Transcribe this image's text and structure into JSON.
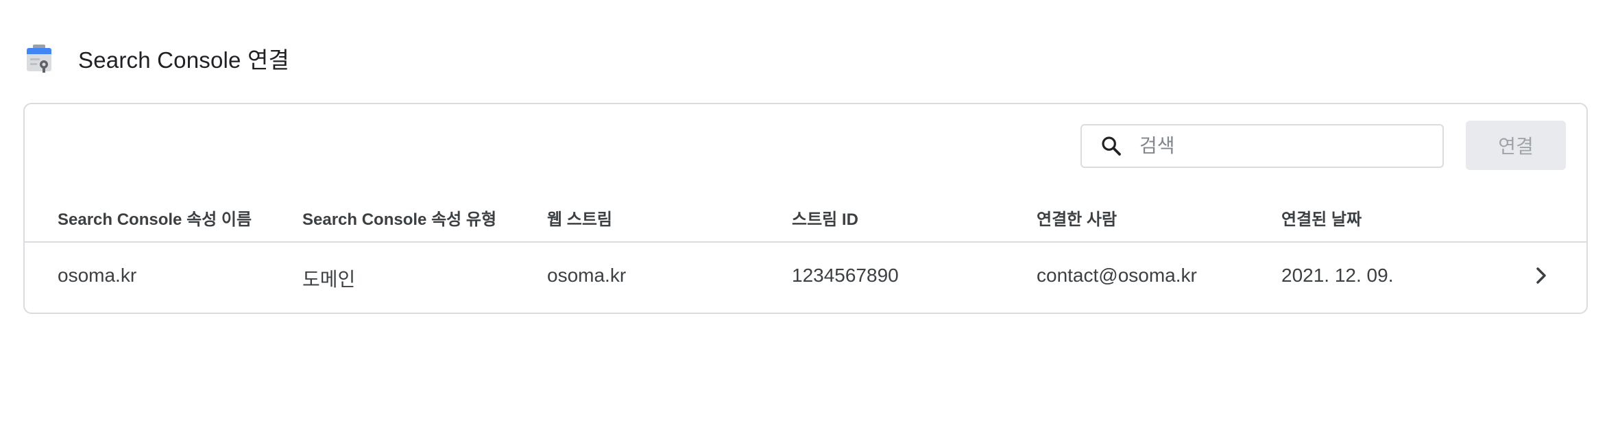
{
  "header": {
    "title": "Search Console 연결",
    "icon": "search-console-icon"
  },
  "toolbar": {
    "search_placeholder": "검색",
    "search_value": "",
    "connect_label": "연결"
  },
  "table": {
    "columns": [
      "Search Console 속성 이름",
      "Search Console 속성 유형",
      "웹 스트림",
      "스트림 ID",
      "연결한 사람",
      "연결된 날짜"
    ],
    "rows": [
      {
        "property_name": "osoma.kr",
        "property_type": "도메인",
        "web_stream": "osoma.kr",
        "stream_id": "1234567890",
        "linked_by": "contact@osoma.kr",
        "linked_date": "2021. 12. 09."
      }
    ]
  },
  "colors": {
    "border": "#dadce0",
    "text": "#202124",
    "disabled_button_bg": "#e8eaed",
    "disabled_button_text": "#a0a4a8"
  }
}
